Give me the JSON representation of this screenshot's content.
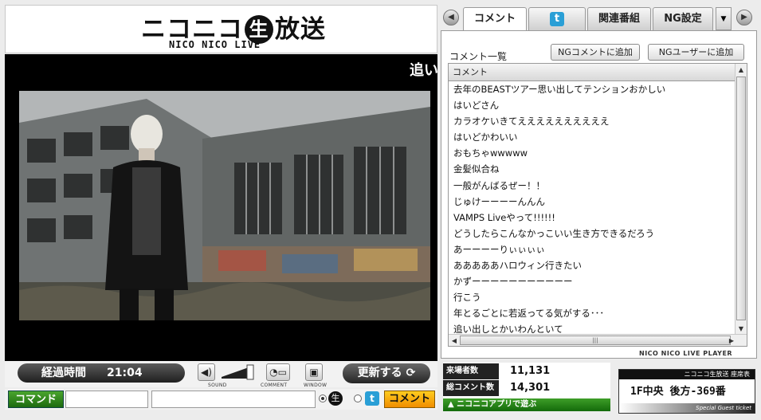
{
  "logo": {
    "main_left": "ニコニコ",
    "main_circle": "生",
    "main_right": "放送",
    "sub": "NICO NICO LIVE"
  },
  "video": {
    "ticker_text": "追い"
  },
  "controls": {
    "elapsed_label": "経過時間",
    "elapsed_value": "21:04",
    "sound_caption": "SOUND",
    "comment_caption": "COMMENT",
    "window_caption": "WINDOW",
    "refresh_label": "更新する",
    "command_label": "コマンド",
    "nama_mark": "生",
    "submit_label": "コメント"
  },
  "tabs": [
    {
      "label": "コメント",
      "active": true
    },
    {
      "label": "t",
      "icon": "twitter-icon"
    },
    {
      "label": "関連番組"
    },
    {
      "label": "NG設定"
    }
  ],
  "comment_panel": {
    "title": "コメント一覧",
    "ng_comment_button": "NGコメントに追加",
    "ng_user_button": "NGユーザーに追加",
    "column_header": "コメント",
    "rows": [
      "去年のBEASTツアー思い出してテンションおかしい",
      "はいどさん",
      "カラオケいきてええええええええええ",
      "はいどかわいい",
      "おもちゃwwwww",
      "金髪似合ね",
      "一般がんばるぜー！！",
      "じゅけーーーーんんん",
      "VAMPS Liveやって!!!!!!",
      "どうしたらこんなかっこいい生き方できるだろう",
      "あーーーーりぃぃぃぃ",
      "あああああハロウィン行きたい",
      "かずーーーーーーーーーーー",
      "行こう",
      "年とるごとに若返ってる気がする･･･",
      "追い出しとかいわんといて"
    ],
    "brand": "NICO NICO LIVE PLAYER"
  },
  "stats": {
    "visitors_label": "来場者数",
    "visitors_value": "11,131",
    "comments_label": "総コメント数",
    "comments_value": "14,301",
    "app_banner": "ニコニコアプリで遊ぶ"
  },
  "ticket": {
    "header": "ニコニコ生放送 座席表",
    "seat": "1F中央 後方-369番",
    "footer": "Special Guest ticket"
  }
}
